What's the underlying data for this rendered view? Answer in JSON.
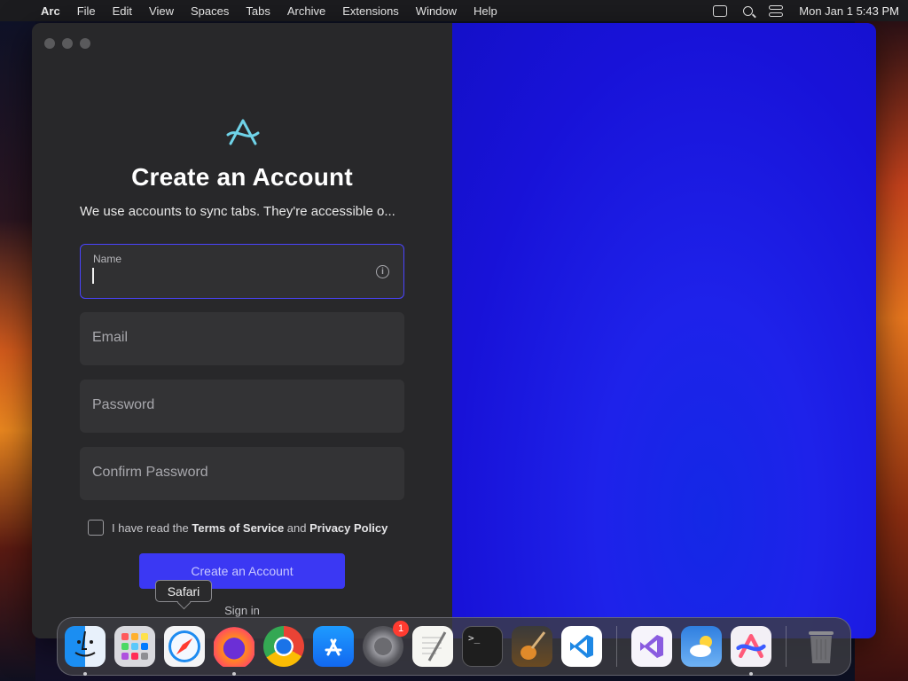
{
  "menubar": {
    "app_name": "Arc",
    "items": [
      "File",
      "Edit",
      "View",
      "Spaces",
      "Tabs",
      "Archive",
      "Extensions",
      "Window",
      "Help"
    ],
    "clock": "Mon Jan 1  5:43 PM"
  },
  "signup": {
    "title": "Create an Account",
    "subtitle": "We use accounts to sync tabs. They're accessible o...",
    "fields": {
      "name_label": "Name",
      "name_value": "",
      "email_placeholder": "Email",
      "password_placeholder": "Password",
      "confirm_placeholder": "Confirm Password"
    },
    "terms": {
      "prefix": "I have read the",
      "tos": "Terms of Service",
      "and": "and",
      "privacy": "Privacy Policy",
      "checked": false
    },
    "cta_label": "Create an Account",
    "signin_label": "Sign in"
  },
  "tooltip": {
    "text": "Safari"
  },
  "dock": {
    "apps": [
      {
        "name": "Finder",
        "icon": "finder-icon",
        "running": true
      },
      {
        "name": "Launchpad",
        "icon": "launchpad-icon",
        "running": false
      },
      {
        "name": "Safari",
        "icon": "safari-icon",
        "running": false
      },
      {
        "name": "Firefox",
        "icon": "firefox-icon",
        "running": true
      },
      {
        "name": "Google Chrome",
        "icon": "chrome-icon",
        "running": false
      },
      {
        "name": "App Store",
        "icon": "appstore-icon",
        "running": false
      },
      {
        "name": "System Settings",
        "icon": "settings-icon",
        "running": false,
        "badge": "1"
      },
      {
        "name": "TextEdit",
        "icon": "textedit-icon",
        "running": false
      },
      {
        "name": "Terminal",
        "icon": "terminal-icon",
        "running": false
      },
      {
        "name": "GarageBand",
        "icon": "garageband-icon",
        "running": false
      },
      {
        "name": "Visual Studio Code",
        "icon": "vscode-icon",
        "running": false
      },
      {
        "name": "Visual Studio",
        "icon": "visual-studio-icon",
        "running": false
      },
      {
        "name": "Weather",
        "icon": "weather-icon",
        "running": false
      },
      {
        "name": "Arc",
        "icon": "arc-icon",
        "running": true
      },
      {
        "name": "Trash",
        "icon": "trash-icon",
        "running": false
      }
    ]
  },
  "colors": {
    "accent": "#3b38f3",
    "focus_border": "#4a43ff",
    "right_panel": "#1e22ea"
  }
}
